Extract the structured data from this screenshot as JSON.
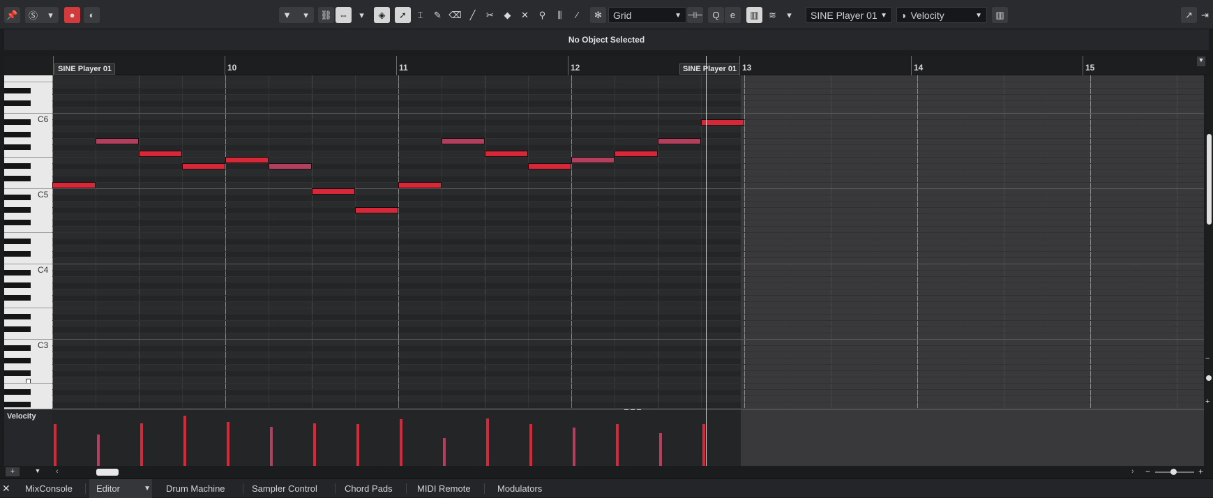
{
  "toolbar": {
    "quantize": "Grid",
    "instrument": "SINE Player 01",
    "lane_parameter": "Velocity"
  },
  "info_line": "No Object Selected",
  "ruler": {
    "bars": [
      "10",
      "11",
      "12",
      "13",
      "14",
      "15"
    ],
    "part_label_1": "SINE Player 01",
    "part_label_2": "SINE Player 01"
  },
  "keyboard": {
    "labels": [
      "C6",
      "C5",
      "C4",
      "C3"
    ]
  },
  "notes_pitch": [
    72,
    79,
    77,
    75,
    76,
    75,
    71,
    68,
    72,
    79,
    77,
    75,
    76,
    77,
    79,
    82
  ],
  "notes_velocity": [
    100,
    75,
    102,
    121,
    106,
    94,
    102,
    100,
    112,
    67,
    113,
    100,
    92,
    100,
    79,
    100
  ],
  "colors": {
    "note_red": "#d7283a",
    "note_pink": "#b0405e",
    "accent": "#d23b3b"
  },
  "lane": {
    "label": "Velocity"
  },
  "bottom_tabs": [
    "MixConsole",
    "Editor",
    "Drum Machine",
    "Sampler Control",
    "Chord Pads",
    "MIDI Remote",
    "Modulators"
  ]
}
